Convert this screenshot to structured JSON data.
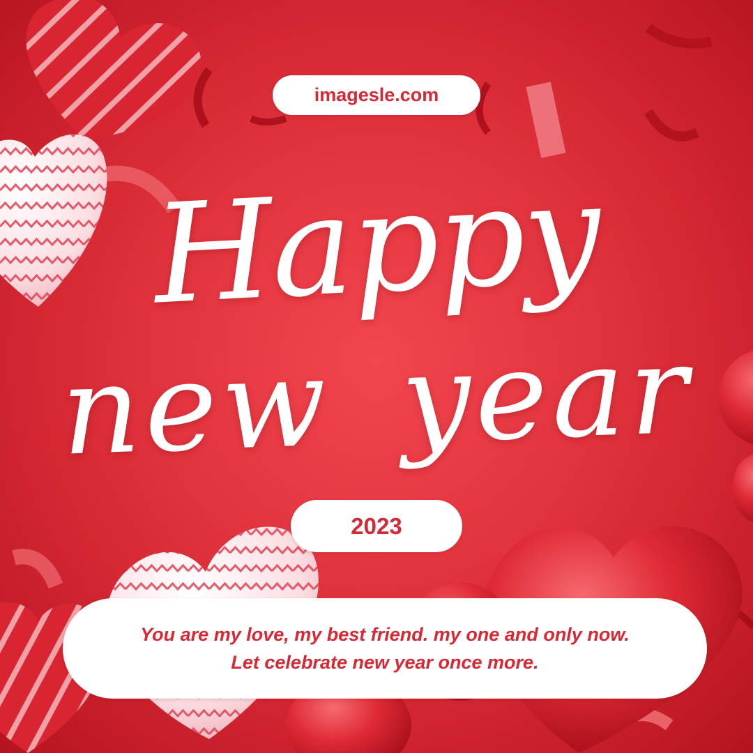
{
  "site": {
    "label": "imagesle.com"
  },
  "greeting": {
    "line1": "Happy",
    "line2": "new  year"
  },
  "year": {
    "label": "2023"
  },
  "message": {
    "line1": "You are my love, my best friend. my one and only now.",
    "line2": "Let celebrate new year once more."
  },
  "colors": {
    "background": "#e2343e",
    "accent_text": "#d42a36",
    "pill_fill": "#ffffff",
    "script_text": "#ffffff"
  },
  "icons": [
    "heart-balloon-icon",
    "confetti-icon"
  ]
}
